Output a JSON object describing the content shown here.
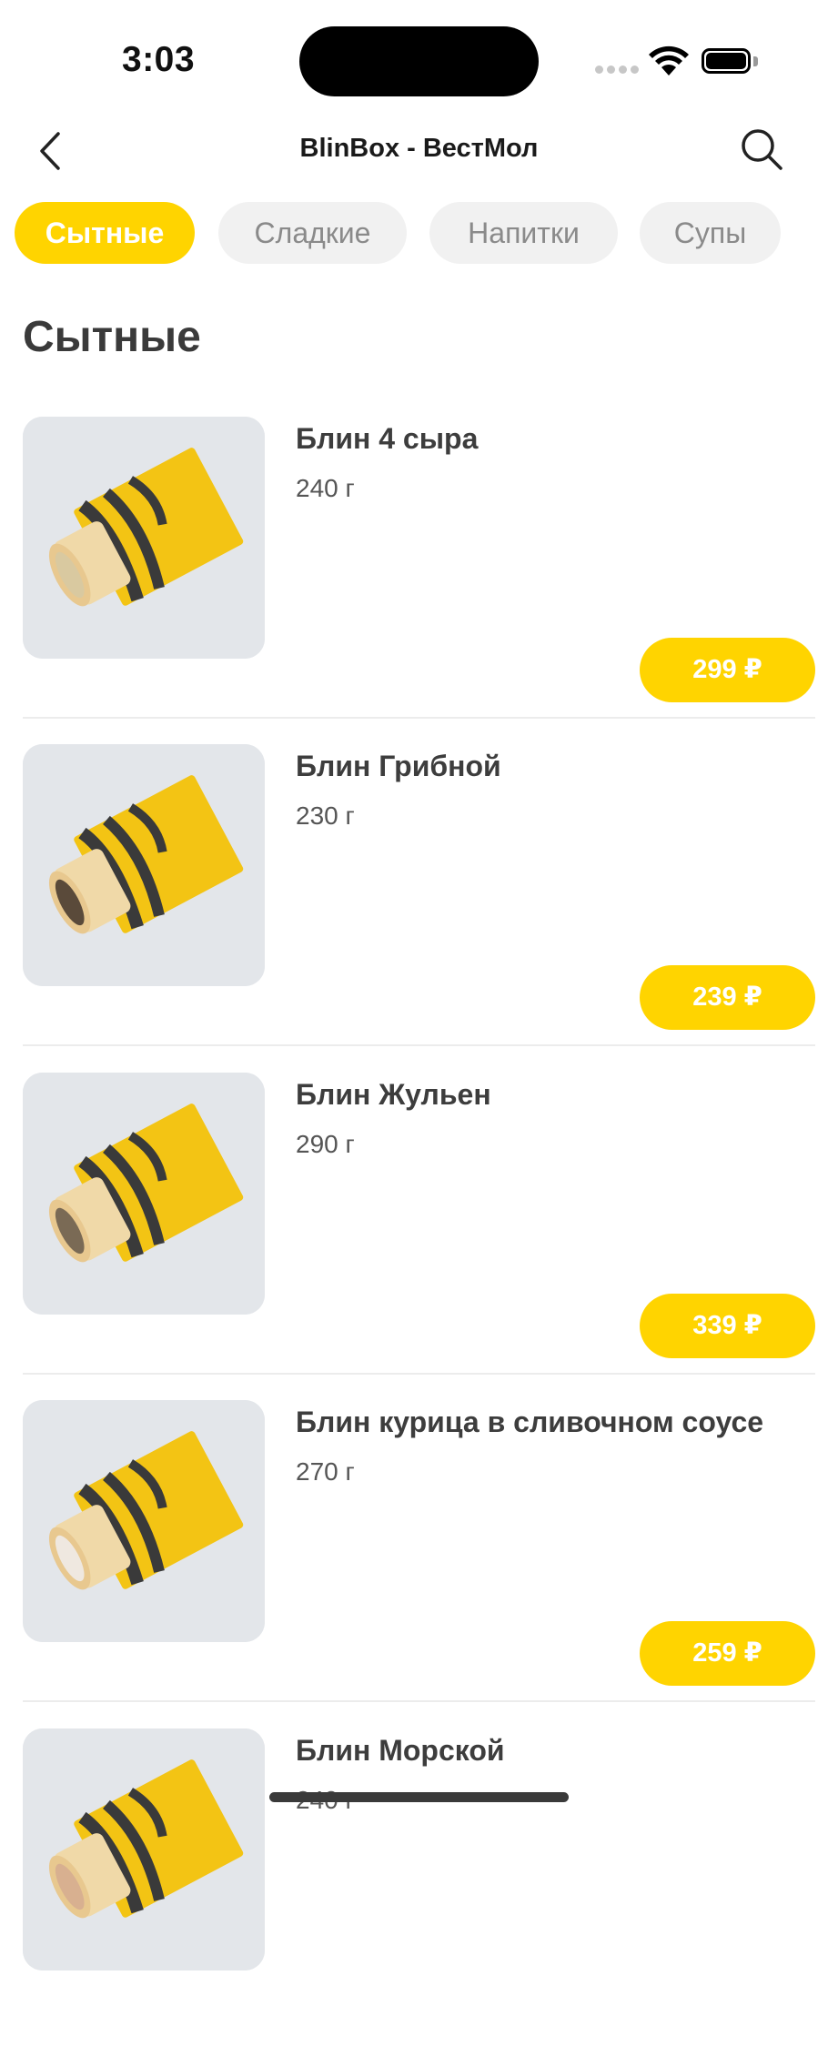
{
  "status_bar": {
    "time": "3:03"
  },
  "header": {
    "title": "BlinBox - ВестМол"
  },
  "tabs": [
    {
      "label": "Сытные",
      "active": true
    },
    {
      "label": "Сладкие",
      "active": false
    },
    {
      "label": "Напитки",
      "active": false
    },
    {
      "label": "Супы",
      "active": false
    }
  ],
  "section": {
    "title": "Сытные"
  },
  "products": [
    {
      "name": "Блин 4 сыра",
      "weight": "240 г",
      "price": "299 ₽",
      "filling_color": "#d9c9a0"
    },
    {
      "name": "Блин Грибной",
      "weight": "230 г",
      "price": "239 ₽",
      "filling_color": "#5a4a3a"
    },
    {
      "name": "Блин Жульен",
      "weight": "290 г",
      "price": "339 ₽",
      "filling_color": "#7a6a55"
    },
    {
      "name": "Блин курица в сливочном соусе",
      "weight": "270 г",
      "price": "259 ₽",
      "filling_color": "#efe8e0"
    },
    {
      "name": "Блин Морской",
      "weight": "240 г",
      "price": "",
      "filling_color": "#d8b090"
    }
  ],
  "colors": {
    "accent": "#ffd400",
    "tab_inactive_bg": "#f1f1f1",
    "tab_inactive_text": "#8a8a8a",
    "image_bg": "#e3e6ea",
    "wrapper": "#f3c414"
  }
}
